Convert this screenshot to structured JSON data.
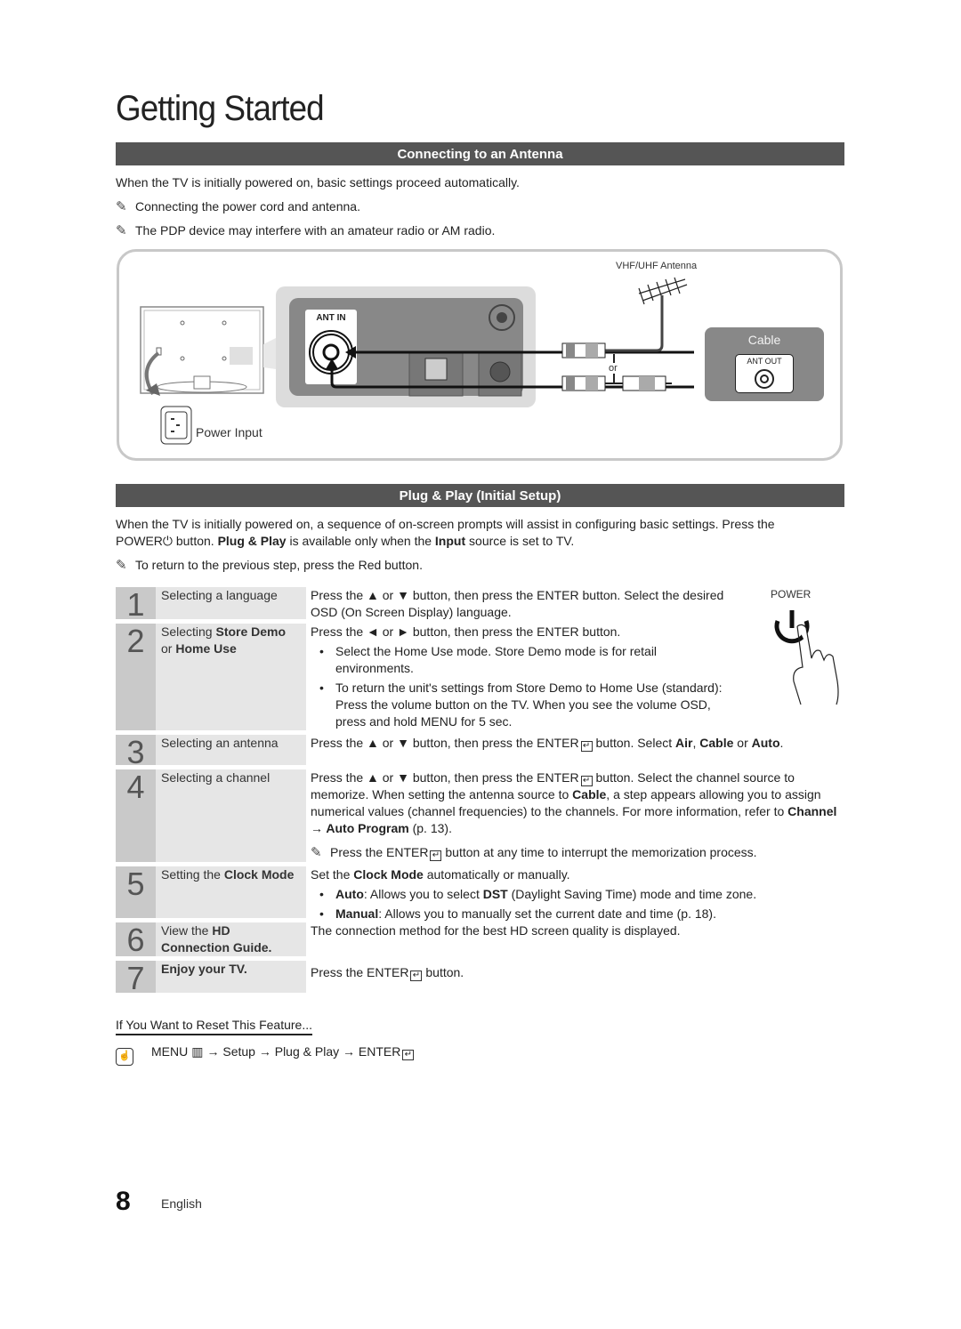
{
  "page_title": "Getting Started",
  "section_antenna": {
    "heading": "Connecting to an Antenna",
    "intro": "When the TV is initially powered on, basic settings proceed automatically.",
    "notes": [
      "Connecting the power cord and antenna.",
      "The PDP device may interfere with an amateur radio or AM radio."
    ],
    "diagram": {
      "ant_in_label": "ANT IN",
      "antenna_label": "VHF/UHF Antenna",
      "or_label": "or",
      "cable_label": "Cable",
      "ant_out_label": "ANT OUT",
      "power_input_label": "Power Input"
    }
  },
  "section_plug_play": {
    "heading": "Plug & Play (Initial Setup)",
    "intro_line1": "When the TV is initially powered on, a sequence of on-screen prompts will assist in configuring basic settings. Press the",
    "intro_power": "POWER",
    "intro_line2a": " button. ",
    "intro_bold1": "Plug & Play",
    "intro_line2b": " is available only when the ",
    "intro_bold2": "Input",
    "intro_line2c": " source is set to TV.",
    "note": "To return to the previous step, press the Red button.",
    "power_label": "POWER",
    "enter_word": "ENTER",
    "steps": [
      {
        "num": "1",
        "label": "Selecting a language",
        "desc": [
          "Press the ▲ or ▼ button, then press the ENTER button. Select the desired OSD (On Screen Display) language."
        ]
      },
      {
        "num": "2",
        "label_pre": "Selecting ",
        "label_b1": "Store Demo",
        "label_mid": " or ",
        "label_b2": "Home Use",
        "desc_line": "Press the ◄ or ► button, then press the ENTER button.",
        "bullets": [
          "Select the Home Use mode. Store Demo mode is for retail environments.",
          "To return the unit's settings from Store Demo to Home Use (standard): Press the volume button on the TV. When you see the volume OSD, press and hold MENU for 5 sec."
        ]
      },
      {
        "num": "3",
        "label": "Selecting an antenna",
        "desc_pre": "Press the ▲ or ▼ button, then press the ENTER",
        "desc_post": " button. Select ",
        "opt1": "Air",
        "sep1": ", ",
        "opt2": "Cable",
        "sep2": " or ",
        "opt3": "Auto",
        "end": "."
      },
      {
        "num": "4",
        "label": "Selecting a channel",
        "desc_pre": "Press the ▲ or ▼ button, then press the ENTER",
        "desc_post": " button. Select the channel source to memorize. When setting the antenna source to ",
        "bold": "Cable",
        "desc_rest": ", a step appears allowing you to assign numerical values (channel frequencies) to the channels. For more information, refer to ",
        "ref": "Channel → Auto Program",
        "ref_page": " (p. 13).",
        "note_pre": "Press the ENTER",
        "note_post": " button at any time to interrupt the memorization process."
      },
      {
        "num": "5",
        "label_pre": "Setting the ",
        "label_b": "Clock Mode",
        "desc_pre": "Set the ",
        "desc_b": "Clock Mode",
        "desc_post": " automatically or manually.",
        "bullets": [
          {
            "b": "Auto",
            "t": ": Allows you to select ",
            "b2": "DST",
            "t2": " (Daylight Saving Time) mode and time zone."
          },
          {
            "b": "Manual",
            "t": ": Allows you to manually set the current date and time (p. 18).",
            "b2": "",
            "t2": ""
          }
        ]
      },
      {
        "num": "6",
        "label_pre": "View the ",
        "label_b": "HD Connection Guide.",
        "desc": "The connection method for the best HD screen quality is displayed."
      },
      {
        "num": "7",
        "label": "Enjoy your TV.",
        "desc_pre": "Press the ENTER",
        "desc_post": " button."
      }
    ]
  },
  "reset": {
    "title": "If You Want to Reset This Feature...",
    "path": [
      "MENU",
      "Setup",
      "Plug & Play",
      "ENTER"
    ],
    "arrow": "→"
  },
  "footer": {
    "page_number": "8",
    "language": "English"
  }
}
